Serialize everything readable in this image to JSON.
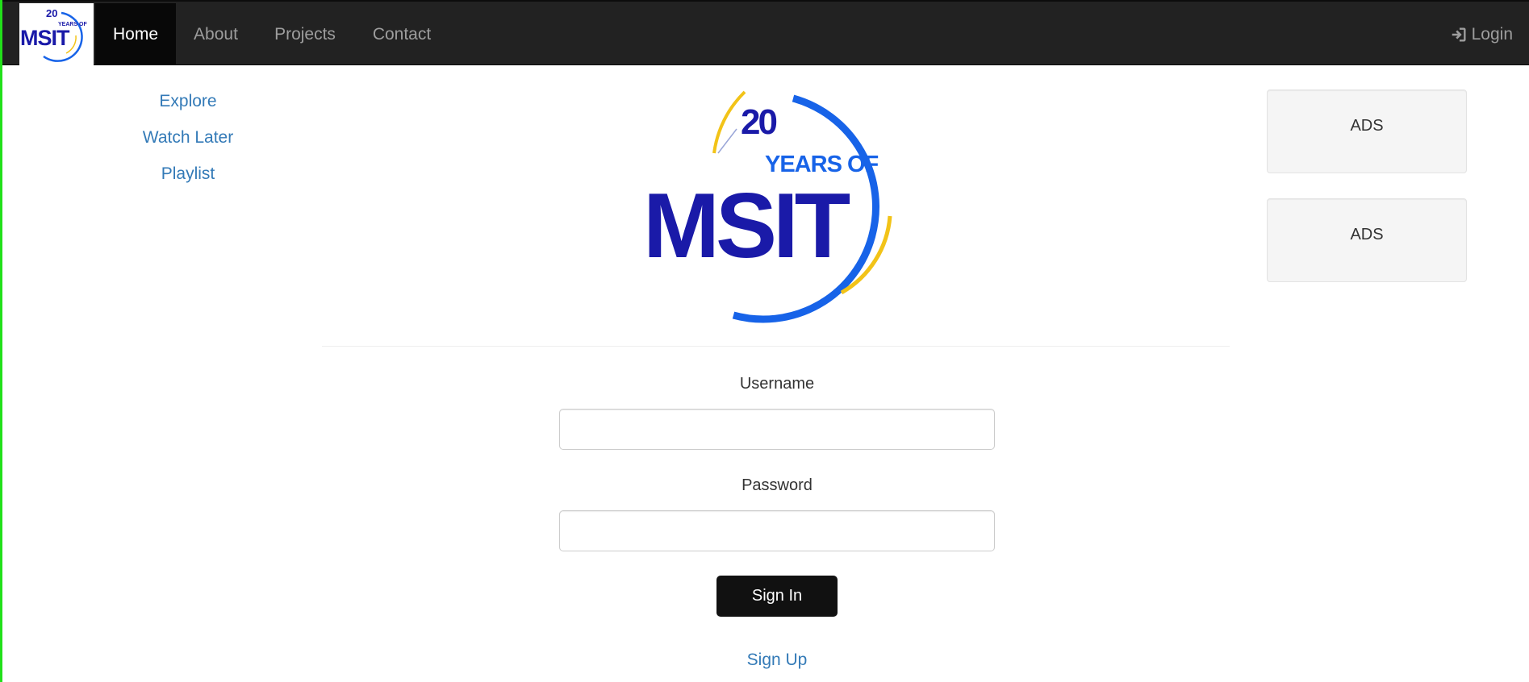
{
  "navbar": {
    "brand": {
      "logo_icon": "msit-20-years-logo",
      "number": "20",
      "tagline": "YEARS OF",
      "wordmark": "MSIT"
    },
    "items": [
      {
        "label": "Home",
        "active": true
      },
      {
        "label": "About",
        "active": false
      },
      {
        "label": "Projects",
        "active": false
      },
      {
        "label": "Contact",
        "active": false
      }
    ],
    "login": {
      "label": "Login",
      "icon": "login-icon"
    }
  },
  "sidebar": {
    "links": [
      {
        "label": "Explore"
      },
      {
        "label": "Watch Later"
      },
      {
        "label": "Playlist"
      }
    ]
  },
  "main": {
    "logo": {
      "number": "20",
      "tagline": "YEARS OF",
      "wordmark": "MSIT"
    },
    "form": {
      "username_label": "Username",
      "username_value": "",
      "password_label": "Password",
      "password_value": "",
      "signin_label": "Sign In",
      "signup_label": "Sign Up"
    }
  },
  "ads": [
    {
      "label": "ADS"
    },
    {
      "label": "ADS"
    }
  ],
  "colors": {
    "navbar_bg": "#222222",
    "link": "#337ab7",
    "logo_dark_blue": "#1a1aa8",
    "logo_blue": "#1763e8",
    "logo_gold": "#f2c318",
    "accent_left_border": "#22e01a"
  }
}
